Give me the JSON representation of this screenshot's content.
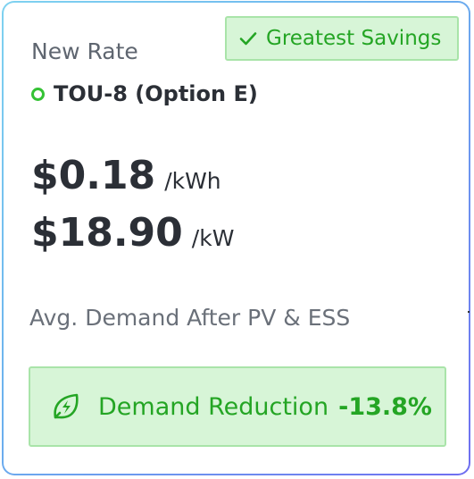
{
  "badge": {
    "label": "Greatest Savings",
    "icon": "check-icon"
  },
  "rate": {
    "heading": "New Rate",
    "name": "TOU-8 (Option E)",
    "status_icon": "ring-icon"
  },
  "prices": [
    {
      "amount": "$0.18",
      "unit": "/kWh"
    },
    {
      "amount": "$18.90",
      "unit": "/kW"
    }
  ],
  "demand": {
    "heading": "Avg. Demand After PV & ESS",
    "label": "Demand Reduction",
    "value": "-13.8%",
    "icon": "leaf-bolt-icon"
  },
  "colors": {
    "accent_green": "#24a524",
    "badge_bg": "#d7f5d7",
    "badge_border": "#a9e4a9",
    "text_dark": "#2b2f36",
    "text_muted": "#5f6670",
    "border_gradient_start": "#7fd2f0",
    "border_gradient_end": "#6f6ef0"
  }
}
